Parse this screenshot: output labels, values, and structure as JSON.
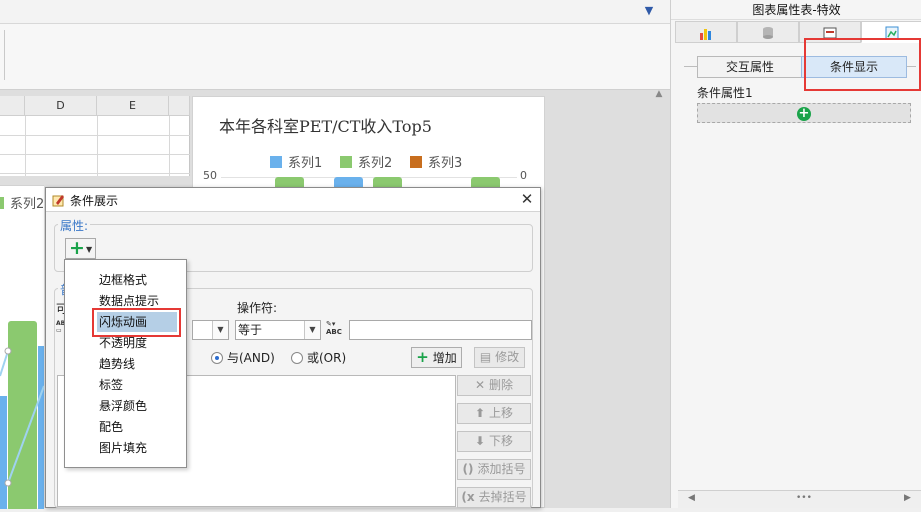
{
  "panel": {
    "title": "图表属性表-特效",
    "sub_tabs": [
      "交互属性",
      "条件显示"
    ],
    "condition_label": "条件属性1"
  },
  "sheet": {
    "columns": [
      "D",
      "E"
    ]
  },
  "chart": {
    "title": "本年各科室PET/CT收入Top5",
    "legend": [
      "系列1",
      "系列2",
      "系列3"
    ],
    "y_left": "50",
    "y_right": "0",
    "left_legend": "系列2"
  },
  "chart_data": {
    "type": "bar",
    "title": "本年各科室PET/CT收入Top5",
    "series": [
      {
        "name": "系列1",
        "color": "#6ab1ec"
      },
      {
        "name": "系列2",
        "color": "#8bc96f"
      },
      {
        "name": "系列3",
        "color": "#c86e1e"
      }
    ],
    "ylim": [
      0,
      50
    ]
  },
  "dialog": {
    "title": "条件展示",
    "property_group": "属性:",
    "ordinary_group": "普",
    "ke_label": "可",
    "operator_label": "操作符:",
    "operator_value": "等于",
    "radio_and": "与(AND)",
    "radio_or": "或(OR)",
    "btn_add": "增加",
    "btn_edit": "修改",
    "btn_delete": "删除",
    "btn_up": "上移",
    "btn_down": "下移",
    "btn_add_paren": "添加括号",
    "btn_remove_paren": "去掉括号"
  },
  "menu": {
    "items": [
      "边框格式",
      "数据点提示",
      "闪烁动画",
      "不透明度",
      "趋势线",
      "标签",
      "悬浮颜色",
      "配色",
      "图片填充"
    ],
    "selected": "闪烁动画"
  },
  "colors": {
    "accent_green": "#1aa34a",
    "highlight_red": "#e53935",
    "menu_selected": "#b5cfe6"
  }
}
